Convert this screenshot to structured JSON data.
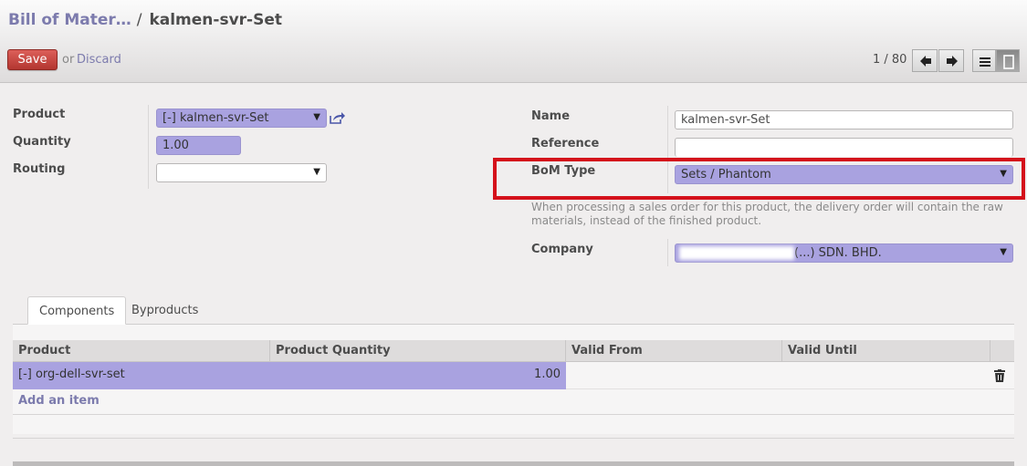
{
  "breadcrumb": {
    "parent": "Bill of Mater…",
    "separator": "/",
    "current": "kalmen-svr-Set"
  },
  "toolbar": {
    "save_label": "Save",
    "or_label": "or",
    "discard_label": "Discard"
  },
  "pager": {
    "text": "1 / 80"
  },
  "left_form": {
    "product_label": "Product",
    "product_value": "[-] kalmen-svr-Set",
    "quantity_label": "Quantity",
    "quantity_value": "1.00",
    "routing_label": "Routing",
    "routing_value": ""
  },
  "right_form": {
    "name_label": "Name",
    "name_value": "kalmen-svr-Set",
    "reference_label": "Reference",
    "reference_value": "",
    "bom_type_label": "BoM Type",
    "bom_type_value": "Sets / Phantom",
    "bom_type_help": "When processing a sales order for this product, the delivery order will contain the raw materials, instead of the finished product.",
    "company_label": "Company",
    "company_value": "(...) SDN. BHD."
  },
  "tabs": [
    {
      "label": "Components"
    },
    {
      "label": "Byproducts"
    }
  ],
  "table": {
    "headers": [
      "Product",
      "Product Quantity",
      "Valid From",
      "Valid Until"
    ],
    "rows": [
      {
        "product": "[-] org-dell-svr-set",
        "quantity": "1.00",
        "valid_from": "",
        "valid_until": ""
      }
    ],
    "add_item_label": "Add an item"
  },
  "colors": {
    "accent": "#7c7bad",
    "required_field": "#a9a2e0",
    "save_button": "#c1403a",
    "highlight_box": "#d4111b"
  }
}
